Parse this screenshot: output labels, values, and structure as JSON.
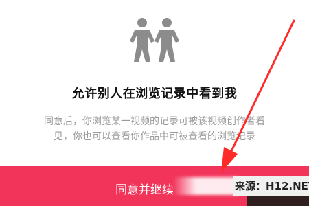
{
  "permission": {
    "title": "允许别人在浏览记录中看到我",
    "description_line1": "同意后，你浏览某一视频的记录可被该视频创作者看",
    "description_line2": "见，你也可以查看你作品中可被查看的浏览记录",
    "icon": "two-people-icon",
    "agree_label": "同意并继续"
  },
  "watermark": {
    "text": "来源：H12.NET"
  },
  "colors": {
    "accent": "#f2335a",
    "title": "#111111",
    "description": "#9b9b9b",
    "icon": "#8c8c8c",
    "annotation_arrow": "#ff2a2a"
  }
}
